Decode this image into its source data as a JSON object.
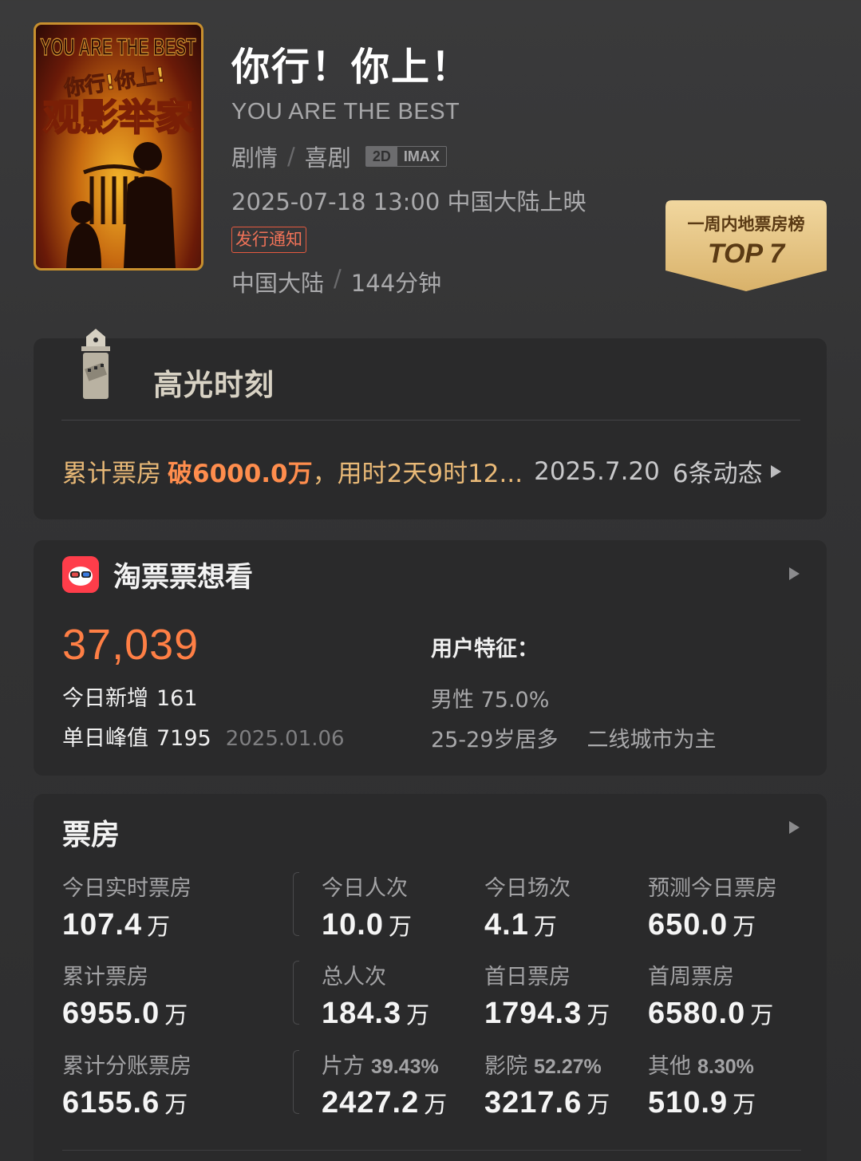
{
  "movie": {
    "title": "你行！你上！",
    "subtitle": "YOU ARE THE BEST",
    "genres": [
      "剧情",
      "喜剧"
    ],
    "formats": [
      "2D",
      "IMAX"
    ],
    "release": "2025-07-18 13:00 中国大陆上映",
    "notice": "发行通知",
    "region": "中国大陆",
    "duration": "144分钟",
    "poster_text": {
      "top": "YOU ARE THE BEST",
      "mid": "你行!你上!",
      "main": "观影举家"
    }
  },
  "badge": {
    "top": "一周内地票房榜",
    "main": "TOP 7"
  },
  "highlight": {
    "title": "高光时刻",
    "text_a": "累计票房",
    "text_b": "破6000.0万",
    "text_c": "，用时2天9时12...",
    "date": "2025.7.20",
    "count": "6条动态"
  },
  "taopiao": {
    "title": "淘票票想看",
    "total": "37,039",
    "today_label": "今日新增",
    "today_value": "161",
    "peak_label": "单日峰值",
    "peak_value": "7195",
    "peak_date": "2025.01.06",
    "user_title": "用户特征：",
    "user_gender": "男性 75.0%",
    "user_age": "25-29岁居多",
    "user_city": "二线城市为主"
  },
  "boxoffice": {
    "title": "票房",
    "unit": "万",
    "stats": [
      {
        "label": "今日实时票房",
        "value": "107.4"
      },
      {
        "label": "今日人次",
        "value": "10.0"
      },
      {
        "label": "今日场次",
        "value": "4.1"
      },
      {
        "label": "预测今日票房",
        "value": "650.0"
      },
      {
        "label": "累计票房",
        "value": "6955.0"
      },
      {
        "label": "总人次",
        "value": "184.3"
      },
      {
        "label": "首日票房",
        "value": "1794.3"
      },
      {
        "label": "首周票房",
        "value": "6580.0"
      },
      {
        "label": "累计分账票房",
        "value": "6155.6"
      },
      {
        "label": "片方",
        "pct": "39.43%",
        "value": "2427.2"
      },
      {
        "label": "影院",
        "pct": "52.27%",
        "value": "3217.6"
      },
      {
        "label": "其他",
        "pct": "8.30%",
        "value": "510.9"
      }
    ]
  },
  "colors": {
    "accent_orange": "#ff7f45",
    "highlight_gold": "#e9b977",
    "notice_red": "#e55a3f",
    "badge_gold": "#e9c98a"
  }
}
